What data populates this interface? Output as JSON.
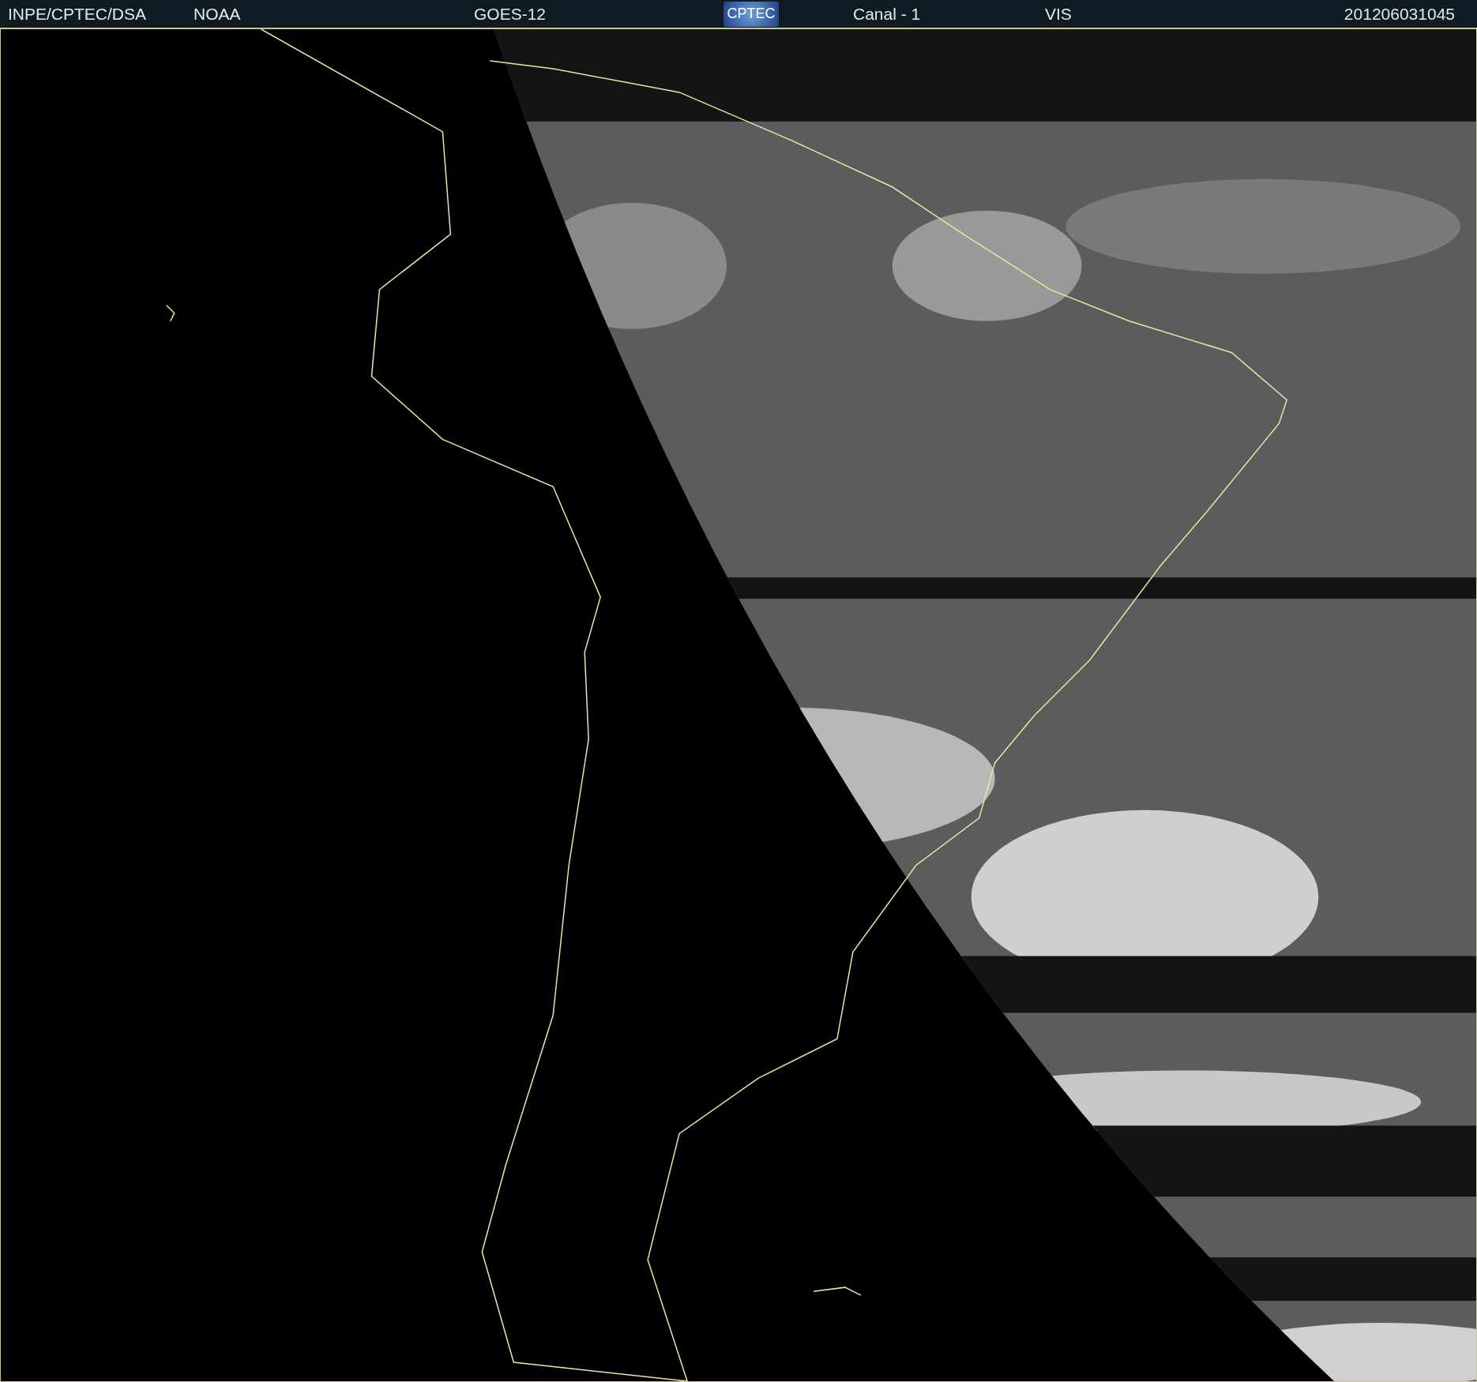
{
  "header": {
    "agency": "INPE/CPTEC/DSA",
    "provider": "NOAA",
    "satellite": "GOES-12",
    "logo": "CPTEC",
    "channel": "Canal - 1",
    "band": "VIS",
    "timestamp": "201206031045"
  }
}
